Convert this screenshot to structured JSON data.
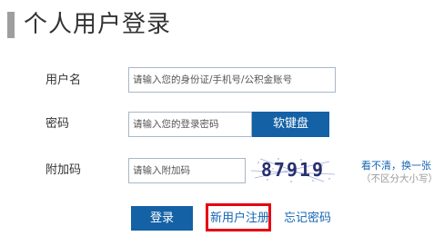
{
  "page": {
    "title": "个人用户登录"
  },
  "form": {
    "username": {
      "label": "用户名",
      "placeholder": "请输入您的身份证/手机号/公积金账号",
      "value": ""
    },
    "password": {
      "label": "密码",
      "placeholder": "请输入您的登录密码",
      "value": "",
      "keyboard_button": "软键盘"
    },
    "captcha": {
      "label": "附加码",
      "placeholder": "请输入附加码",
      "value": "",
      "image_text": "87919",
      "refresh_link": "看不清，换一张",
      "hint": "（不区分大小写）"
    }
  },
  "actions": {
    "login": "登录",
    "register": "新用户注册",
    "forgot": "忘记密码"
  },
  "colors": {
    "primary": "#1461a6",
    "link": "#1566b3",
    "highlight_border": "#e60012",
    "title_bar": "#9e9e9e"
  }
}
